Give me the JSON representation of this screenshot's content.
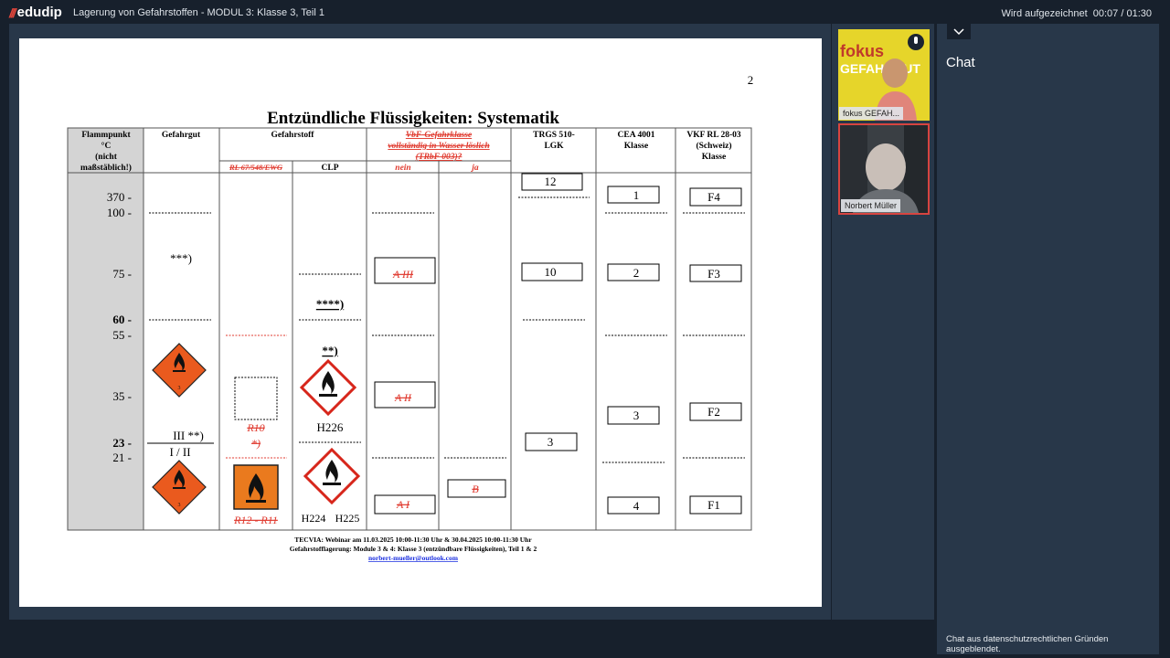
{
  "app": {
    "logo_text": "edudip",
    "title": "Lagerung von Gefahrstoffen - MODUL 3: Klasse 3, Teil 1",
    "recording": "Wird aufgezeichnet",
    "time": "00:07 / 01:30"
  },
  "slide": {
    "page_no": "2",
    "heading": "Entzündliche Flüssigkeiten: Systematik",
    "col_flammpunkt": [
      "Flammpunkt",
      "°C",
      "(nicht",
      "maßstäblich!)"
    ],
    "col_gefahrgut": "Gefahrgut",
    "col_gefahrstoff": "Gefahrstoff",
    "col_rl": "RL 67/548/EWG",
    "col_clp": "CLP",
    "col_vbf": [
      "VbF-Gefahrklasse",
      "vollständig in Wasser löslich",
      "(TRbF 003)?"
    ],
    "col_nein": "nein",
    "col_ja": "ja",
    "col_trgs": [
      "TRGS 510-",
      "LGK"
    ],
    "col_cea": [
      "CEA 4001",
      "Klasse"
    ],
    "col_vkf": [
      "VKF RL 28-03",
      "(Schweiz)",
      "Klasse"
    ],
    "temps": {
      "t370": "370 -",
      "t100": "100 -",
      "t75": "75 -",
      "t60": "60 -",
      "t55": "55 -",
      "t35": "35 -",
      "t23": "23 -",
      "t21": "21 -"
    },
    "gefahrgut_notes": {
      "stars3": "***)",
      "iii": "III **)",
      "i_ii": "I / II"
    },
    "rl_notes": {
      "r10": "R10",
      "r10_fn": "*)",
      "r12": "R12 - R11"
    },
    "clp_notes": {
      "stars4": "****)",
      "stars2": "**)",
      "h226": "H226",
      "h224": "H224",
      "h225": "H225"
    },
    "vbf": {
      "aiii": "A III",
      "aii": "A II",
      "ai": "A I",
      "b": "B"
    },
    "trgs": {
      "v12": "12",
      "v10": "10",
      "v3": "3"
    },
    "cea": {
      "v1": "1",
      "v2": "2",
      "v3": "3",
      "v4": "4"
    },
    "vkf": {
      "f4": "F4",
      "f3": "F3",
      "f2": "F2",
      "f1": "F1"
    },
    "footer": [
      "TECVIA: Webinar am 11.03.2025 10:00-11:30 Uhr & 30.04.2025 10:00-11:30 Uhr",
      "Gefahrstofflagerung: Module 3 & 4: Klasse 3 (entzündbare Flüssigkeiten), Teil 1 & 2",
      "norbert-mueller@outlook.com"
    ]
  },
  "participants": [
    {
      "name": "fokus GEFAH...",
      "video_text_1": "fokus",
      "video_text_2": "GEFAHRGUT"
    },
    {
      "name": "Norbert Müller"
    }
  ],
  "chat": {
    "title": "Chat",
    "notice": "Chat aus datenschutzrechtlichen Gründen ausgeblendet."
  },
  "colors": {
    "bg": "#17202c",
    "panel": "#283749",
    "accent": "#e2463b",
    "strike_red": "#e03a2f",
    "hazard_orange": "#ea5a1e"
  }
}
